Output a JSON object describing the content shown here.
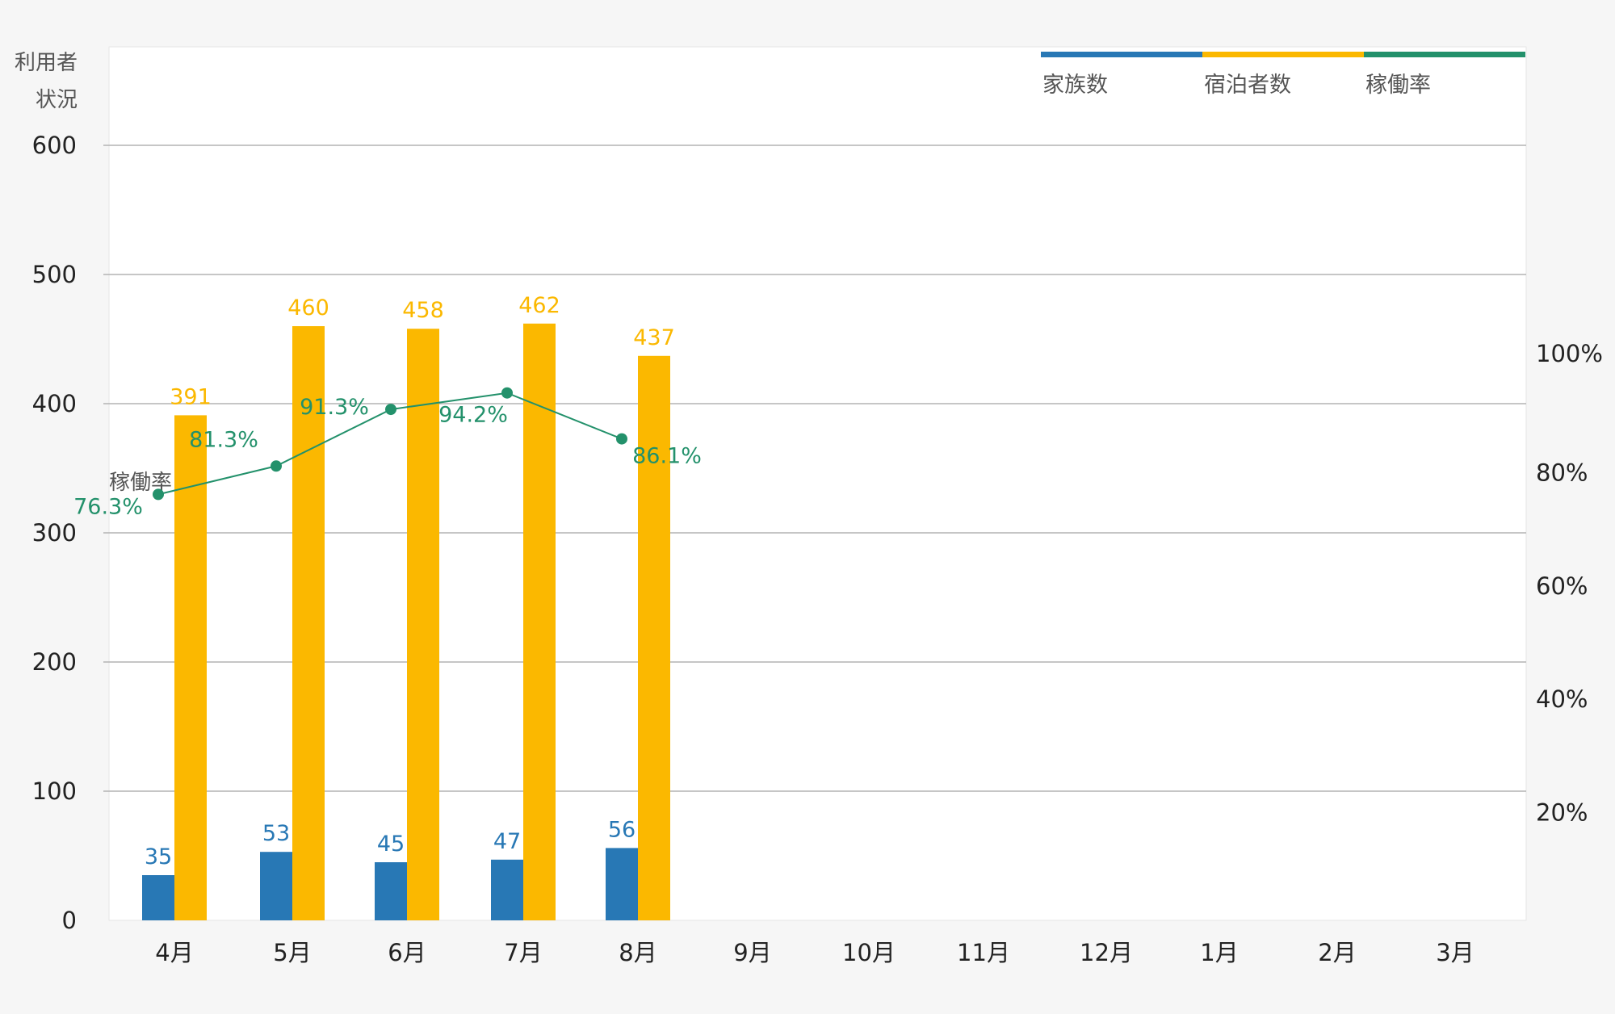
{
  "chart_data": {
    "type": "bar",
    "categories": [
      "4月",
      "5月",
      "6月",
      "7月",
      "8月",
      "9月",
      "10月",
      "11月",
      "12月",
      "1月",
      "2月",
      "3月"
    ],
    "series": [
      {
        "name": "家族数",
        "type": "bar",
        "axis": "left",
        "color": "#2878b5",
        "values": [
          35,
          53,
          45,
          47,
          56,
          null,
          null,
          null,
          null,
          null,
          null,
          null
        ],
        "labels": [
          "35",
          "53",
          "45",
          "47",
          "56"
        ]
      },
      {
        "name": "宿泊者数",
        "type": "bar",
        "axis": "left",
        "color": "#fbb800",
        "values": [
          391,
          460,
          458,
          462,
          437,
          null,
          null,
          null,
          null,
          null,
          null,
          null
        ],
        "labels": [
          "391",
          "460",
          "458",
          "462",
          "437"
        ]
      },
      {
        "name": "稼働率",
        "type": "line",
        "axis": "right",
        "color": "#23916b",
        "values": [
          76.3,
          81.3,
          91.3,
          94.2,
          86.1,
          null,
          null,
          null,
          null,
          null,
          null,
          null
        ],
        "labels": [
          "76.3%",
          "81.3%",
          "91.3%",
          "94.2%",
          "86.1%"
        ]
      }
    ],
    "y_left": {
      "title_lines": [
        "利用者",
        "状況"
      ],
      "ticks": [
        "0",
        "100",
        "200",
        "300",
        "400",
        "500",
        "600"
      ],
      "range": [
        0,
        600
      ]
    },
    "y_right": {
      "ticks": [
        "20%",
        "40%",
        "60%",
        "80%",
        "100%"
      ]
    },
    "inner_label": "稼働率",
    "legend_position": "top-right",
    "grid": true
  }
}
